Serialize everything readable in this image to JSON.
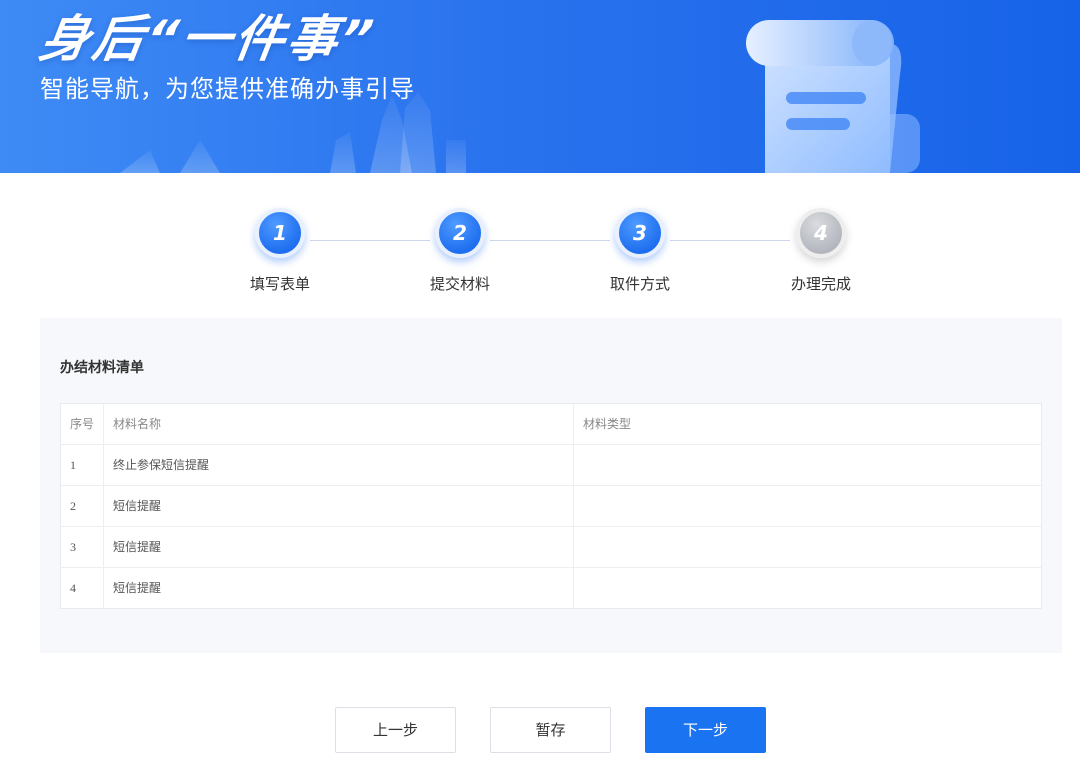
{
  "banner": {
    "title": "身后“一件事”",
    "subtitle": "智能导航，为您提供准确办事引导"
  },
  "stepper": {
    "steps": [
      {
        "number": "1",
        "label": "填写表单",
        "state": "done"
      },
      {
        "number": "2",
        "label": "提交材料",
        "state": "done"
      },
      {
        "number": "3",
        "label": "取件方式",
        "state": "active"
      },
      {
        "number": "4",
        "label": "办理完成",
        "state": "pending"
      }
    ],
    "colors": {
      "active": "#1f6ff0",
      "pending": "#b4b7be"
    }
  },
  "materials": {
    "title": "办结材料清单",
    "columns": {
      "no": "序号",
      "name": "材料名称",
      "type": "材料类型"
    },
    "rows": [
      {
        "no": "1",
        "name": "终止参保短信提醒",
        "type": ""
      },
      {
        "no": "2",
        "name": "短信提醒",
        "type": ""
      },
      {
        "no": "3",
        "name": "短信提醒",
        "type": ""
      },
      {
        "no": "4",
        "name": "短信提醒",
        "type": ""
      }
    ]
  },
  "actions": {
    "prev": "上一步",
    "save": "暂存",
    "next": "下一步",
    "primary_color": "#1a73f0"
  }
}
